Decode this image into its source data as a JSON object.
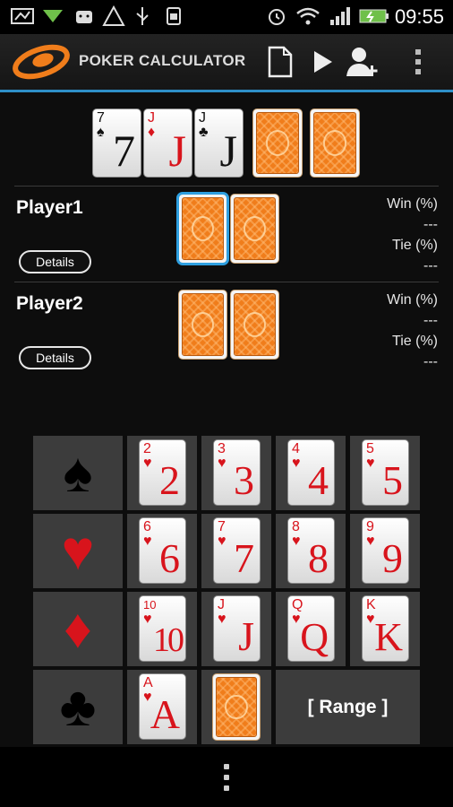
{
  "status_bar": {
    "time": "09:55",
    "icons": [
      "screenshot-icon",
      "download-arrow-icon",
      "android-onoff-icon",
      "warning-icon",
      "usb-icon",
      "android-debug-icon",
      "alarm-icon",
      "wifi-icon",
      "signal-icon",
      "battery-charging-icon"
    ]
  },
  "app": {
    "title": "POKER CALCULATOR",
    "actions": [
      "new-file-icon",
      "play-icon",
      "add-player-icon",
      "overflow-menu-icon"
    ]
  },
  "board": [
    {
      "rank": "7",
      "suit": "♠",
      "color": "black"
    },
    {
      "rank": "J",
      "suit": "♦",
      "color": "red"
    },
    {
      "rank": "J",
      "suit": "♣",
      "color": "black"
    },
    {
      "back": true
    },
    {
      "back": true
    }
  ],
  "players": [
    {
      "name": "Player1",
      "details_label": "Details",
      "win_label": "Win (%)",
      "win_value": "---",
      "tie_label": "Tie (%)",
      "tie_value": "---"
    },
    {
      "name": "Player2",
      "details_label": "Details",
      "win_label": "Win (%)",
      "win_value": "---",
      "tie_label": "Tie (%)",
      "tie_value": "---"
    }
  ],
  "picker": {
    "suits": [
      {
        "symbol": "♠",
        "color": "#000000"
      },
      {
        "symbol": "♥",
        "color": "#d8141c"
      },
      {
        "symbol": "♦",
        "color": "#d8141c"
      },
      {
        "symbol": "♣",
        "color": "#000000"
      }
    ],
    "selected_suit_symbol": "♥",
    "ranks": [
      "2",
      "3",
      "4",
      "5",
      "6",
      "7",
      "8",
      "9",
      "10",
      "J",
      "Q",
      "K",
      "A"
    ],
    "range_label": "[ Range ]"
  },
  "colors": {
    "accent": "#2e8fc7",
    "card_red": "#d8141c",
    "card_back": "#f07d1b",
    "cell_bg": "#3c3c3c"
  }
}
